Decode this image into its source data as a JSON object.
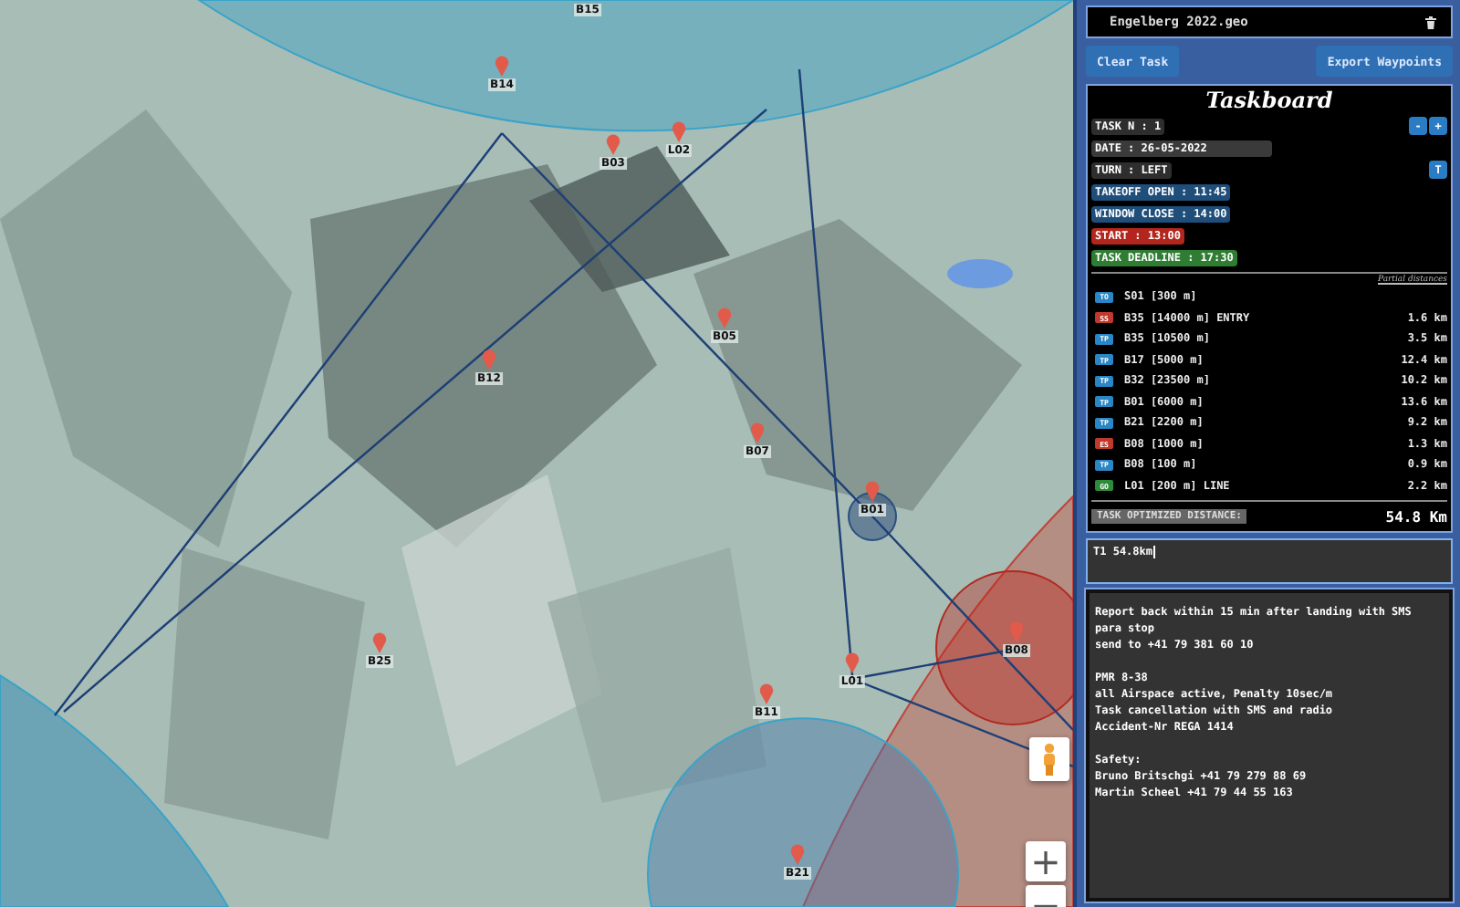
{
  "map": {
    "waypoints": [
      {
        "label": "B15"
      },
      {
        "label": "B14"
      },
      {
        "label": "L02"
      },
      {
        "label": "B03"
      },
      {
        "label": "B12"
      },
      {
        "label": "B05"
      },
      {
        "label": "B07"
      },
      {
        "label": "B01"
      },
      {
        "label": "B25"
      },
      {
        "label": "L01"
      },
      {
        "label": "B11"
      },
      {
        "label": "B08"
      },
      {
        "label": "B21"
      }
    ],
    "zoom_in": "+",
    "zoom_out": "−"
  },
  "panel": {
    "file_name": "Engelberg 2022.geo",
    "buttons": [
      "Clear Task",
      "Export Waypoints"
    ]
  },
  "taskboard": {
    "title": "Taskboard",
    "fields": [
      {
        "text": "TASK N : 1",
        "color": "#2e2e2e",
        "buttons": [
          "-",
          "+"
        ]
      },
      {
        "text": "DATE : 26-05-2022",
        "color": "#3a3a3a",
        "wide": true
      },
      {
        "text": "TURN : LEFT",
        "color": "#2e2e2e",
        "buttons": [
          "T"
        ]
      },
      {
        "text": "TAKEOFF OPEN : 11:45",
        "color": "#1f4e7a"
      },
      {
        "text": "WINDOW CLOSE : 14:00",
        "color": "#1f4e7a"
      },
      {
        "text": "START : 13:00",
        "color": "#b3261e"
      },
      {
        "text": "TASK DEADLINE : 17:30",
        "color": "#2e7d32"
      }
    ],
    "distances_heading": "Partial distances",
    "turnpoints": [
      {
        "type": "TO",
        "color": "#2a86c5",
        "name": "S01 [300 m]"
      },
      {
        "type": "SS",
        "color": "#c0392b",
        "name": "B35 [14000 m] ENTRY",
        "distance": "1.6 km"
      },
      {
        "type": "TP",
        "color": "#2a86c5",
        "name": "B35 [10500 m]",
        "distance": "3.5 km"
      },
      {
        "type": "TP",
        "color": "#2a86c5",
        "name": "B17 [5000 m]",
        "distance": "12.4 km"
      },
      {
        "type": "TP",
        "color": "#2a86c5",
        "name": "B32 [23500 m]",
        "distance": "10.2 km"
      },
      {
        "type": "TP",
        "color": "#2a86c5",
        "name": "B01 [6000 m]",
        "distance": "13.6 km"
      },
      {
        "type": "TP",
        "color": "#2a86c5",
        "name": "B21 [2200 m]",
        "distance": "9.2 km"
      },
      {
        "type": "ES",
        "color": "#c0392b",
        "name": "B08 [1000 m]",
        "distance": "1.3 km"
      },
      {
        "type": "TP",
        "color": "#2a86c5",
        "name": "B08 [100 m]",
        "distance": "0.9 km"
      },
      {
        "type": "GO",
        "color": "#2e8b3a",
        "name": "L01 [200 m] LINE",
        "distance": "2.2 km"
      }
    ],
    "optimized_label": "TASK OPTIMIZED DISTANCE:",
    "optimized_value": "54.8 Km"
  },
  "summary": {
    "value": "T1 54.8km"
  },
  "notes": {
    "value": "Report back within 15 min after landing with SMS\npara stop\nsend to +41 79 381 60 10\n\nPMR 8-38\nall Airspace active, Penalty 10sec/m\nTask cancellation with SMS and radio\nAccident-Nr REGA 1414\n\nSafety:\nBruno Britschgi +41 79 279 88 69\nMartin Scheel +41 79 44 55 163"
  }
}
